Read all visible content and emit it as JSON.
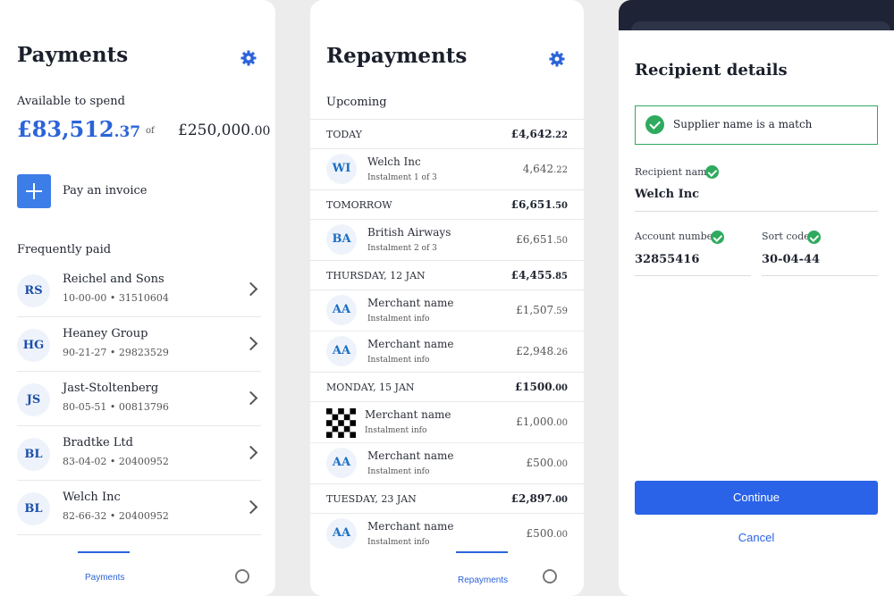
{
  "payments": {
    "title": "Payments",
    "available_label": "Available to spend",
    "available_pounds": "£83,512",
    "available_pence": ".37",
    "of_label": "of",
    "limit_pounds": "£250,000",
    "limit_pence": ".00",
    "pay_invoice_label": "Pay an invoice",
    "frequently_paid_label": "Frequently paid",
    "payees": [
      {
        "initials": "RS",
        "name": "Reichel and Sons",
        "detail": "10-00-00 • 31510604"
      },
      {
        "initials": "HG",
        "name": "Heaney Group",
        "detail": "90-21-27 • 29823529"
      },
      {
        "initials": "JS",
        "name": "Jast-Stoltenberg",
        "detail": "80-05-51 • 00813796"
      },
      {
        "initials": "BL",
        "name": "Bradtke Ltd",
        "detail": "83-04-02 • 20400952"
      },
      {
        "initials": "BL",
        "name": "Welch Inc",
        "detail": "82-66-32 • 20400952"
      }
    ],
    "tab_label": "Payments"
  },
  "repayments": {
    "title": "Repayments",
    "upcoming_label": "Upcoming",
    "groups": [
      {
        "day": "TODAY",
        "total": "£4,642",
        "total_pence": ".22",
        "items": [
          {
            "initials": "WI",
            "name": "Welch Inc",
            "sub": "Instalment 1 of 3",
            "amount": "4,642",
            "pence": ".22"
          }
        ]
      },
      {
        "day": "TOMORROW",
        "total": "£6,651",
        "total_pence": ".50",
        "items": [
          {
            "initials": "BA",
            "name": "British Airways",
            "sub": "Instalment 2 of 3",
            "amount": "£6,651",
            "pence": ".50"
          }
        ]
      },
      {
        "day": "THURSDAY, 12 JAN",
        "total": "£4,455",
        "total_pence": ".85",
        "items": [
          {
            "initials": "AA",
            "name": "Merchant name",
            "sub": "Instalment info",
            "amount": "£1,507",
            "pence": ".59"
          },
          {
            "initials": "AA",
            "name": "Merchant name",
            "sub": "Instalment info",
            "amount": "£2,948",
            "pence": ".26"
          }
        ]
      },
      {
        "day": "MONDAY, 15 JAN",
        "total": "£1500",
        "total_pence": ".00",
        "items": [
          {
            "initials": "",
            "name": "Merchant name",
            "sub": "Instalment info",
            "amount": "£1,000",
            "pence": ".00",
            "logo": "checkered-logo"
          },
          {
            "initials": "AA",
            "name": "Merchant name",
            "sub": "Instalment info",
            "amount": "£500",
            "pence": ".00"
          }
        ]
      },
      {
        "day": "TUESDAY, 23 JAN",
        "total": "£2,897",
        "total_pence": ".00",
        "items": [
          {
            "initials": "AA",
            "name": "Merchant name",
            "sub": "Instalment info",
            "amount": "£500",
            "pence": ".00"
          }
        ]
      }
    ],
    "tab_label": "Repayments"
  },
  "recipient": {
    "title": "Recipient details",
    "match_text": "Supplier name is a match",
    "name_label": "Recipient name",
    "name_value": "Welch Inc",
    "account_label": "Account number",
    "account_value": "32855416",
    "sort_label": "Sort code",
    "sort_value": "30-04-44",
    "continue_label": "Continue",
    "cancel_label": "Cancel"
  },
  "colors": {
    "accent": "#2b63d9",
    "success": "#2faa5e",
    "dark": "#1e2436"
  }
}
